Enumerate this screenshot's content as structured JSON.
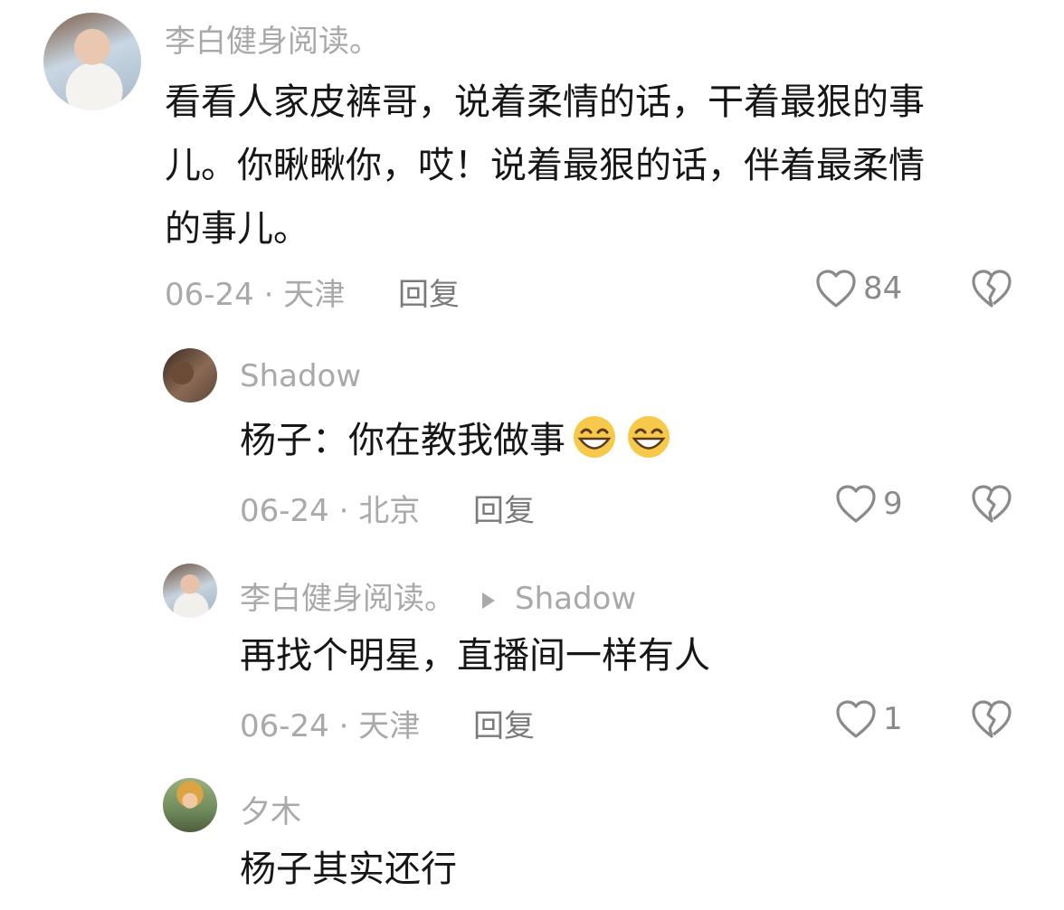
{
  "comments": [
    {
      "author": "李白健身阅读。",
      "text_lines": [
        "看看人家皮裤哥，说着柔情的话，干着最狠的事",
        "儿。你瞅瞅你，哎！说着最狠的话，伴着最柔情",
        "的事儿。"
      ],
      "date": "06-24",
      "location": "天津",
      "reply_label": "回复",
      "likes": "84"
    }
  ],
  "replies": [
    {
      "author": "Shadow",
      "text": "杨子：你在教我做事",
      "emoji": [
        "grin-emoji",
        "grin-emoji"
      ],
      "date": "06-24",
      "location": "北京",
      "reply_label": "回复",
      "likes": "9"
    },
    {
      "author": "李白健身阅读。",
      "reply_to": "Shadow",
      "text": "再找个明星，直播间一样有人",
      "date": "06-24",
      "location": "天津",
      "reply_label": "回复",
      "likes": "1"
    },
    {
      "author": "夕木",
      "text": "杨子其实还行"
    }
  ],
  "colors": {
    "meta": "#a9a9a9",
    "text": "#161616",
    "icon": "#8a8a8a"
  }
}
